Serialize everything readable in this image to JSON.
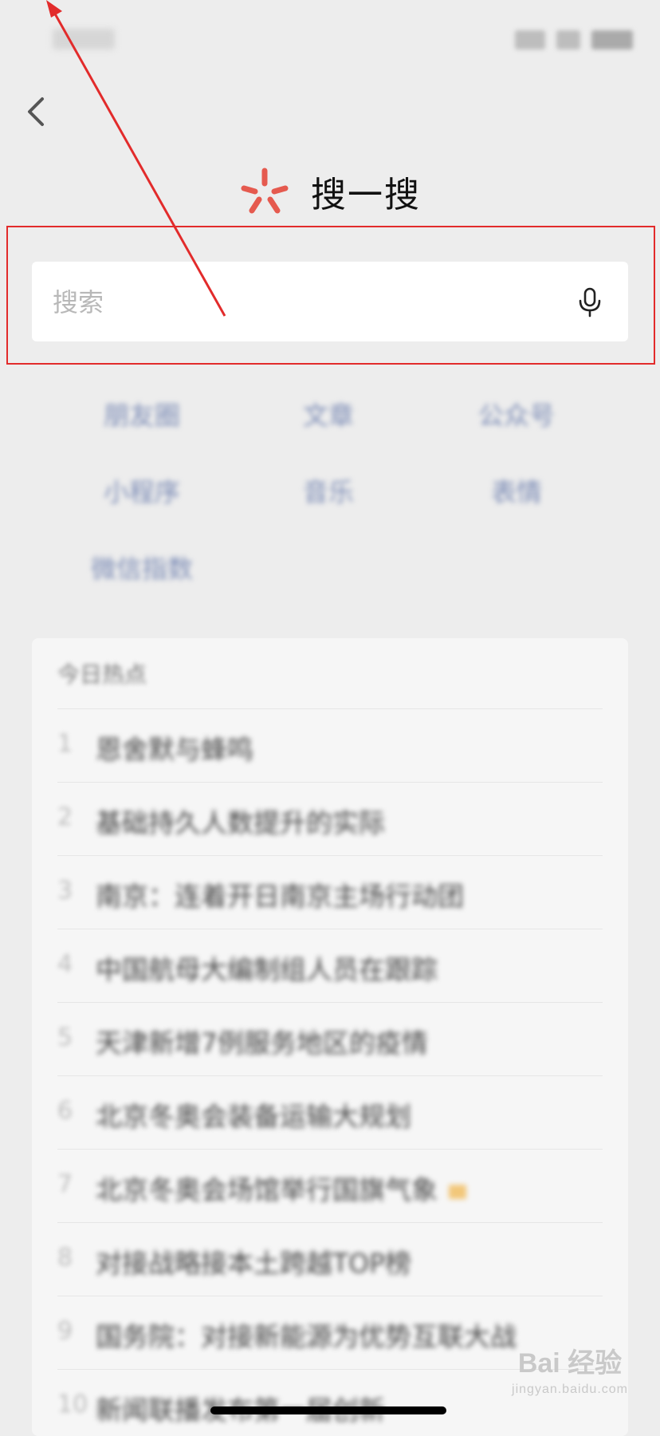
{
  "header": {
    "title": "搜一搜",
    "back_icon": "chevron-left-icon",
    "logo_icon": "sparkle-logo-icon",
    "logo_color": "#e55a4f"
  },
  "search": {
    "placeholder": "搜索",
    "value": "",
    "mic_icon": "microphone-icon"
  },
  "annotation": {
    "highlight_color": "#e22b2b",
    "arrow_color": "#e22b2b"
  },
  "categories": [
    {
      "label": "朋友圈"
    },
    {
      "label": "文章"
    },
    {
      "label": "公众号"
    },
    {
      "label": "小程序"
    },
    {
      "label": "音乐"
    },
    {
      "label": "表情"
    },
    {
      "label": "微信指数"
    }
  ],
  "trending": {
    "title": "今日热点",
    "items": [
      {
        "rank": "1",
        "text": "恩舍默与蜂鸣"
      },
      {
        "rank": "2",
        "text": "基础持久人数提升的实际"
      },
      {
        "rank": "3",
        "text": "南京：连着开日南京主场行动团"
      },
      {
        "rank": "4",
        "text": "中国航母大编制组人员在跟踪"
      },
      {
        "rank": "5",
        "text": "天津新增7例服务地区的疫情"
      },
      {
        "rank": "6",
        "text": "北京冬奥会装备运输大规划"
      },
      {
        "rank": "7",
        "text": "北京冬奥会场馆举行国旗气象",
        "hot": true
      },
      {
        "rank": "8",
        "text": "对接战略接本土跨越TOP榜"
      },
      {
        "rank": "9",
        "text": "国务院：对接新能源为优势互联大战"
      },
      {
        "rank": "10",
        "text": "新闻联播发布第一届创新"
      }
    ]
  },
  "watermark": {
    "brand": "Bai 经验",
    "site": "jingyan.baidu.com"
  }
}
